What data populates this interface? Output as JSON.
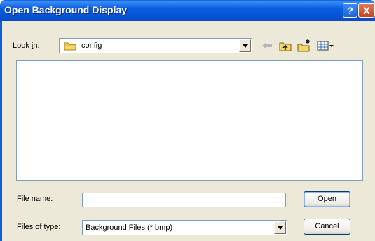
{
  "window": {
    "title": "Open Background Display",
    "help_label": "?",
    "close_label": "X"
  },
  "lookin": {
    "label_pre": "Look ",
    "label_key": "i",
    "label_post": "n:",
    "value": "config"
  },
  "toolbar": {
    "icons": [
      "back-arrow-icon",
      "up-one-level-icon",
      "create-new-folder-icon",
      "view-menu-icon"
    ]
  },
  "filename": {
    "label_pre": "File ",
    "label_key": "n",
    "label_post": "ame:",
    "value": ""
  },
  "filetype": {
    "label_pre": "Files of ",
    "label_key": "t",
    "label_post": "ype:",
    "value": "Background Files (*.bmp)"
  },
  "buttons": {
    "open_key": "O",
    "open_rest": "pen",
    "cancel": "Cancel"
  },
  "colors": {
    "titlebar": "#0b5ee0",
    "dialog_bg": "#ece9d8",
    "border": "#7f9db9"
  }
}
